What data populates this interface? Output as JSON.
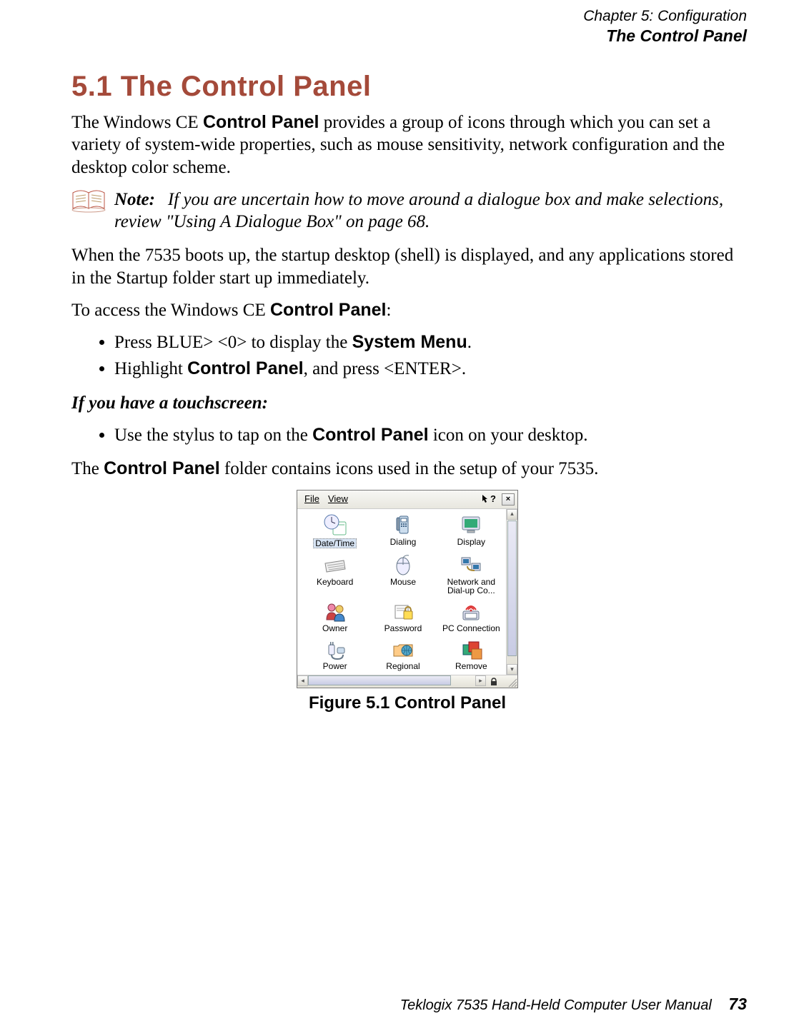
{
  "header": {
    "chapter": "Chapter 5: Configuration",
    "section": "The Control Panel"
  },
  "heading": "5.1  The Control Panel",
  "para1": {
    "t1": "The Windows CE ",
    "bold1": "Control Panel",
    "t2": " provides a group of icons through which you can set a variety of system-wide properties, such as mouse sensitivity, network configuration and the desktop color scheme."
  },
  "note": {
    "label": "Note:",
    "text": "If you are uncertain how to move around a dialogue box and make selec­tions, review \"Using A Dialogue Box\" on page 68."
  },
  "para2": "When the 7535 boots up, the startup desktop (shell) is displayed, and any applications stored in the Startup folder start up immediately.",
  "para3": {
    "t1": "To access the Windows CE ",
    "bold1": "Control Panel",
    "t2": ":"
  },
  "bullets1": {
    "b1": {
      "t1": "Press BLUE> <0> to display the ",
      "bold1": "System Menu",
      "t2": "."
    },
    "b2": {
      "t1": "Highlight ",
      "bold1": "Control Panel",
      "t2": ", and press <ENTER>."
    }
  },
  "touchscreen_heading": "If you have a touchscreen:",
  "bullets2": {
    "b1": {
      "t1": "Use the stylus to tap on the ",
      "bold1": "Control Panel",
      "t2": " icon on your desktop."
    }
  },
  "para4": {
    "t1": "The ",
    "bold1": "Control Panel",
    "t2": " folder contains icons used in the setup of your 7535."
  },
  "figure_caption": "Figure 5.1 Control Panel",
  "cp_window": {
    "menu": {
      "file": "File",
      "view": "View",
      "help": "?",
      "close": "×"
    },
    "icons": [
      {
        "label": "Date/Time"
      },
      {
        "label": "Dialing"
      },
      {
        "label": "Display"
      },
      {
        "label": "Keyboard"
      },
      {
        "label": "Mouse"
      },
      {
        "label": "Network and Dial-up Co..."
      },
      {
        "label": "Owner"
      },
      {
        "label": "Password"
      },
      {
        "label": "PC Connection"
      },
      {
        "label": "Power"
      },
      {
        "label": "Regional"
      },
      {
        "label": "Remove"
      }
    ]
  },
  "footer": {
    "text": "Teklogix 7535 Hand-Held Computer User Manual",
    "page": "73"
  }
}
